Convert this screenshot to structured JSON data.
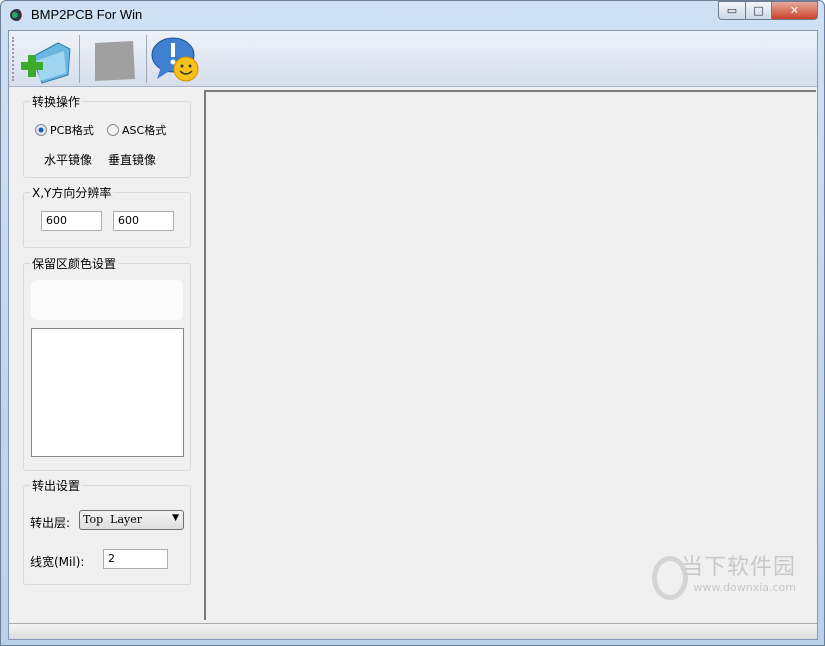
{
  "window": {
    "title": "BMP2PCB For Win",
    "minimize": "▭",
    "maximize": "□",
    "close": "✕"
  },
  "toolbar": {
    "items": [
      "open-icon",
      "disabled-icon",
      "about-icon"
    ]
  },
  "convert_ops": {
    "label": "转换操作",
    "radio_pcb": "PCB格式",
    "radio_asc": "ASC格式",
    "pcb_selected": true,
    "mirror_h": "水平镜像",
    "mirror_v": "垂直镜像"
  },
  "resolution": {
    "label": "X,Y方向分辨率",
    "x": "600",
    "y": "600"
  },
  "keep_color": {
    "label": "保留区颜色设置"
  },
  "output": {
    "label": "转出设置",
    "layer_label": "转出层:",
    "layer_value": "Top  Layer",
    "width_label": "线宽(Mil):",
    "width_value": "2"
  },
  "watermark": {
    "text": "当下软件园",
    "url": "www.downxia.com"
  }
}
